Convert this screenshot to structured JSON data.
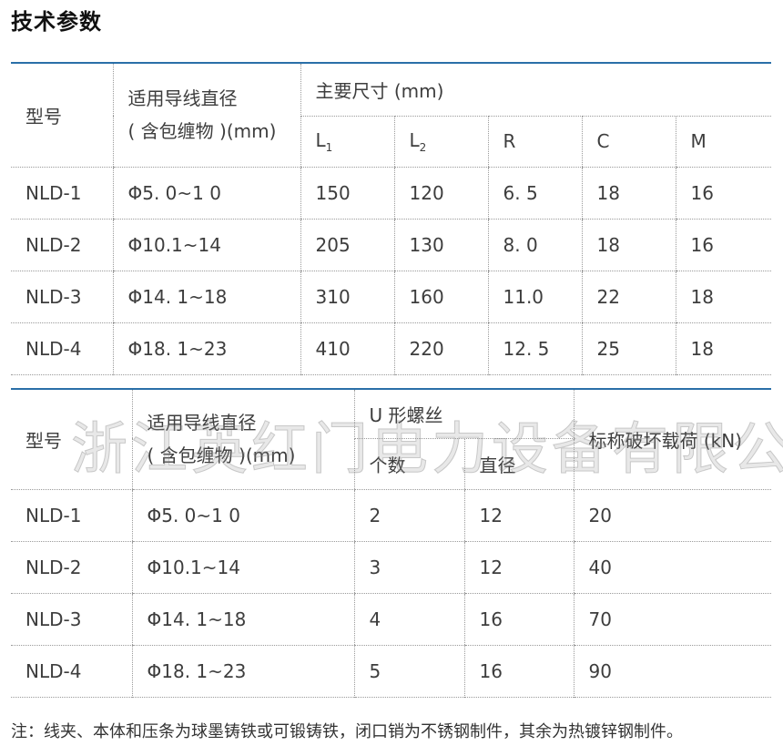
{
  "title": "技术参数",
  "table1": {
    "model_header": "型号",
    "diam_header_line1": "适用导线直径",
    "diam_header_line2": "( 含包缠物 )(mm)",
    "dims_header": "主要尺寸 (mm)",
    "sub": {
      "L1_base": "L",
      "L1_sub": "1",
      "L2_base": "L",
      "L2_sub": "2",
      "R": "R",
      "C": "C",
      "M": "M"
    },
    "rows": [
      {
        "model": "NLD-1",
        "diam": "Φ5. 0~1 0",
        "L1": "150",
        "L2": "120",
        "R": "6. 5",
        "C": "18",
        "M": "16"
      },
      {
        "model": "NLD-2",
        "diam": "Φ10.1~14",
        "L1": "205",
        "L2": "130",
        "R": "8. 0",
        "C": "18",
        "M": "16"
      },
      {
        "model": "NLD-3",
        "diam": "Φ14. 1~18",
        "L1": "310",
        "L2": "160",
        "R": "11.0",
        "C": "22",
        "M": "18"
      },
      {
        "model": "NLD-4",
        "diam": "Φ18. 1~23",
        "L1": "410",
        "L2": "220",
        "R": "12. 5",
        "C": "25",
        "M": "18"
      }
    ]
  },
  "table2": {
    "model_header": "型号",
    "diam_header_line1": "适用导线直径",
    "diam_header_line2": "( 含包缠物 )(mm)",
    "bolt_header": "U 形螺丝",
    "bolt_count": "个数",
    "bolt_diam": "直径",
    "load_header": "标称破坏载荷 (kN)",
    "rows": [
      {
        "model": "NLD-1",
        "diam": "Φ5. 0~1 0",
        "count": "2",
        "bdiam": "12",
        "load": "20"
      },
      {
        "model": "NLD-2",
        "diam": "Φ10.1~14",
        "count": "3",
        "bdiam": "12",
        "load": "40"
      },
      {
        "model": "NLD-3",
        "diam": "Φ14. 1~18",
        "count": "4",
        "bdiam": "16",
        "load": "70"
      },
      {
        "model": "NLD-4",
        "diam": "Φ18. 1~23",
        "count": "5",
        "bdiam": "16",
        "load": "90"
      }
    ]
  },
  "watermark": "浙江英红门电力设备有限公司",
  "note": "注：线夹、本体和压条为球墨铸铁或可锻铸铁，闭口销为不锈钢制件，其余为热镀锌钢制件。"
}
